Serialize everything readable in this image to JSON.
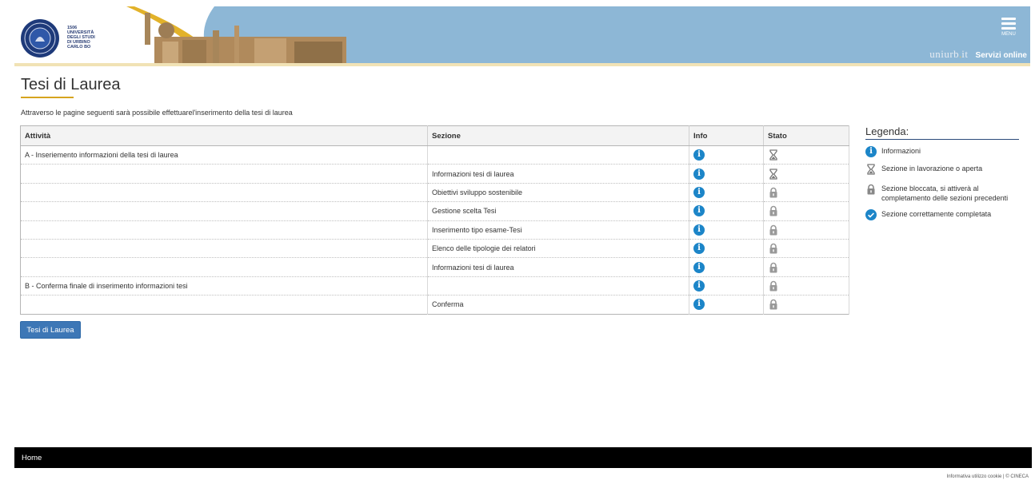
{
  "header": {
    "logo_lines": [
      "1506",
      "UNIVERSITÀ",
      "DEGLI STUDI",
      "DI URBINO",
      "CARLO BO"
    ],
    "menu_label": "MENU",
    "brand_name": "uniurb",
    "brand_suffix": "it",
    "servizi": "Servizi online"
  },
  "page": {
    "title": "Tesi di Laurea",
    "intro": "Attraverso le pagine seguenti sarà possibile effettuarel'inserimento della tesi di laurea"
  },
  "table": {
    "headers": {
      "attivita": "Attività",
      "sezione": "Sezione",
      "info": "Info",
      "stato": "Stato"
    },
    "rows": [
      {
        "attivita": "A - Inseriemento informazioni della tesi di laurea",
        "sezione": "",
        "stato": "hourglass-icon"
      },
      {
        "attivita": "",
        "sezione": "Informazioni tesi di laurea",
        "stato": "hourglass-icon"
      },
      {
        "attivita": "",
        "sezione": "Obiettivi sviluppo sostenibile",
        "stato": "lock-icon"
      },
      {
        "attivita": "",
        "sezione": "Gestione scelta Tesi",
        "stato": "lock-icon"
      },
      {
        "attivita": "",
        "sezione": "Inserimento tipo esame-Tesi",
        "stato": "lock-icon"
      },
      {
        "attivita": "",
        "sezione": "Elenco delle tipologie dei relatori",
        "stato": "lock-icon"
      },
      {
        "attivita": "",
        "sezione": "Informazioni tesi di laurea",
        "stato": "lock-icon"
      },
      {
        "attivita": "B - Conferma finale di inserimento informazioni tesi",
        "sezione": "",
        "stato": "lock-icon"
      },
      {
        "attivita": "",
        "sezione": "Conferma",
        "stato": "lock-icon"
      }
    ],
    "info_glyph": "i"
  },
  "button": {
    "label": "Tesi di Laurea"
  },
  "legend": {
    "title": "Legenda:",
    "items": [
      {
        "icon": "info-icon",
        "text": "Informazioni"
      },
      {
        "icon": "hourglass-icon",
        "text": "Sezione in lavorazione o aperta"
      },
      {
        "icon": "lock-icon",
        "text": "Sezione bloccata, si attiverà al completamento delle sezioni precedenti"
      },
      {
        "icon": "check-circle-icon",
        "text": "Sezione correttamente completata"
      }
    ]
  },
  "footer": {
    "home": "Home",
    "note": "Informativa utilizzo cookie | © CINECA"
  },
  "colors": {
    "header_bg": "#8db7d6",
    "accent_gold": "#d6a41e",
    "info_blue": "#1c85c8",
    "button_blue": "#3d77b6",
    "footer_bg": "#000000"
  }
}
